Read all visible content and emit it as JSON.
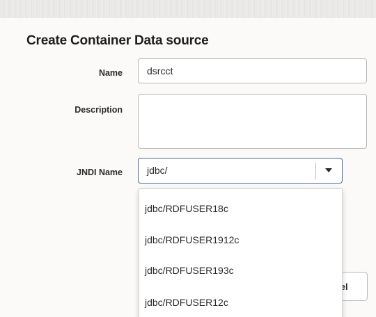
{
  "dialog": {
    "title": "Create Container Data source"
  },
  "form": {
    "name_label": "Name",
    "name_value": "dsrcct",
    "description_label": "Description",
    "description_value": "",
    "jndi_label": "JNDI Name",
    "jndi_value": "jdbc/"
  },
  "dropdown": {
    "options": [
      "jdbc/RDFUSER18c",
      "jdbc/RDFUSER1912c",
      "jdbc/RDFUSER193c",
      "jdbc/RDFUSER12c"
    ]
  },
  "buttons": {
    "cancel_label": "Cancel"
  },
  "colors": {
    "focus_border": "#4a6d96",
    "field_border": "#b9b7b4",
    "background": "#fbfaf9"
  },
  "icons": {
    "dropdown_toggle": "caret-down-icon"
  }
}
